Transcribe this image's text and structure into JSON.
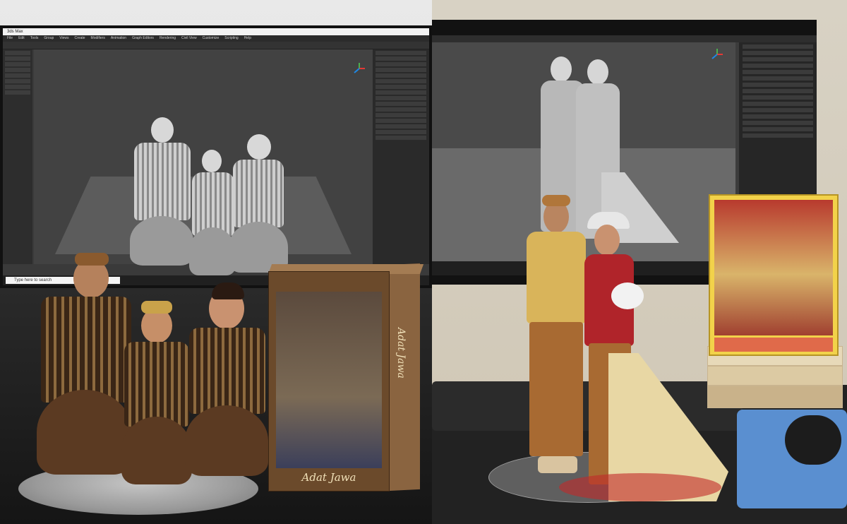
{
  "left_screen": {
    "window_title": "3ds Max",
    "menu_items": [
      "File",
      "Edit",
      "Tools",
      "Group",
      "Views",
      "Create",
      "Modifiers",
      "Animation",
      "Graph Editors",
      "Rendering",
      "Civil View",
      "Customize",
      "Scripting",
      "Help"
    ],
    "taskbar_search": "Type here to search"
  },
  "product_box": {
    "title": "Adat Jawa",
    "spine_text": "Adat Jawa",
    "colors": {
      "box": "#6b4a2b",
      "text": "#f0e0b8"
    }
  },
  "right_screen": {
    "frame_colors": {
      "frame": "#f2d24a",
      "photo": "#b83a2e"
    }
  },
  "icons": [
    "axis-gizmo-icon",
    "search-icon",
    "windows-start-icon"
  ]
}
